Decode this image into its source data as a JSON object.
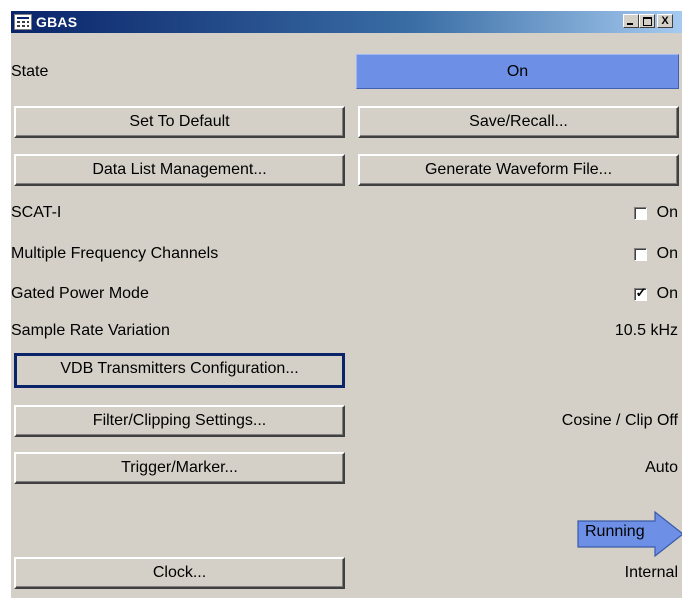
{
  "window": {
    "title": "GBAS",
    "icon": "grid-window-icon",
    "minimize_icon": "minimize-icon",
    "maximize_icon": "maximize-icon",
    "close_icon": "close-icon",
    "close_glyph": "X"
  },
  "state": {
    "label": "State",
    "value": "On",
    "color": "#6d90e6"
  },
  "buttons": {
    "set_default": "Set To Default",
    "save_recall": "Save/Recall...",
    "data_list": "Data List Management...",
    "generate_waveform": "Generate Waveform File...",
    "vdb": "VDB Transmitters Configuration...",
    "filter": "Filter/Clipping Settings...",
    "trigger": "Trigger/Marker...",
    "clock": "Clock..."
  },
  "options": {
    "scat": {
      "label": "SCAT-I",
      "check_label": "On",
      "checked": false
    },
    "multi_freq": {
      "label": "Multiple Frequency Channels",
      "check_label": "On",
      "checked": false
    },
    "gated_power": {
      "label": "Gated Power Mode",
      "check_label": "On",
      "checked": true,
      "check_glyph": "✓"
    }
  },
  "sample_rate": {
    "label": "Sample Rate Variation",
    "value": "10.5 kHz"
  },
  "filter_value": "Cosine / Clip Off",
  "trigger_value": "Auto",
  "running": {
    "label": "Running",
    "color": "#6d90e6",
    "icon": "arrow-right-icon"
  },
  "clock_value": "Internal"
}
